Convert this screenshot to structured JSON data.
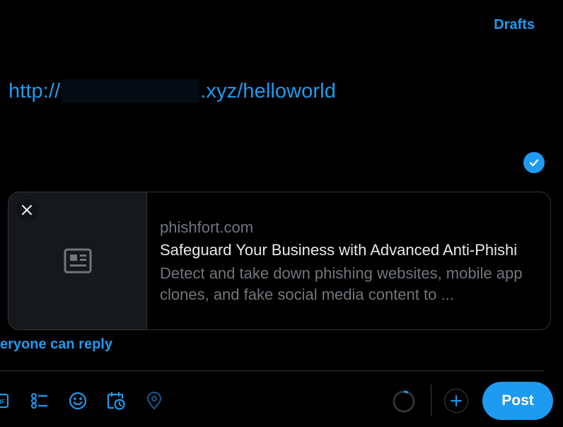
{
  "header": {
    "drafts_label": "Drafts"
  },
  "compose": {
    "url_prefix": "http://",
    "url_suffix": ".xyz/helloworld"
  },
  "link_card": {
    "domain": "phishfort.com",
    "title": "Safeguard Your Business with Advanced Anti-Phishi",
    "description": "Detect and take down phishing websites, mobile app clones, and fake social media content to ...",
    "thumbnail_icon": "article-icon",
    "close_icon": "close-icon"
  },
  "reply_setting": {
    "label": "eryone can reply"
  },
  "toolbar": {
    "icons": [
      "gif-icon",
      "poll-icon",
      "emoji-icon",
      "schedule-icon",
      "location-icon"
    ],
    "post_label": "Post"
  },
  "colors": {
    "accent": "#1d9bf0",
    "background": "#000000",
    "border": "#2f3336",
    "muted_text": "#71767b",
    "primary_text": "#e7e9ea"
  }
}
